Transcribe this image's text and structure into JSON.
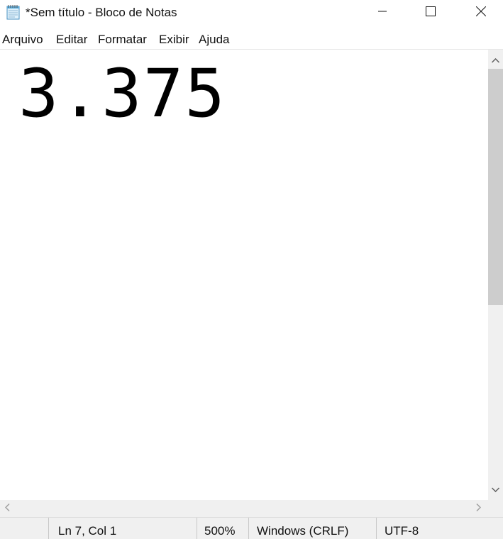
{
  "window": {
    "title": "*Sem título - Bloco de Notas",
    "icon": "notepad-icon",
    "controls": [
      "minimize-icon",
      "maximize-icon",
      "close-icon"
    ]
  },
  "menu": {
    "items": [
      "Arquivo",
      "Editar",
      "Formatar",
      "Exibir",
      "Ajuda"
    ]
  },
  "editor": {
    "content": "3.375"
  },
  "status": {
    "position": "Ln 7, Col 1",
    "zoom": "500%",
    "line_ending": "Windows (CRLF)",
    "encoding": "UTF-8"
  },
  "colors": {
    "background": "#ffffff",
    "chrome": "#f0f0f0",
    "scroll_thumb": "#cdcdcd"
  }
}
